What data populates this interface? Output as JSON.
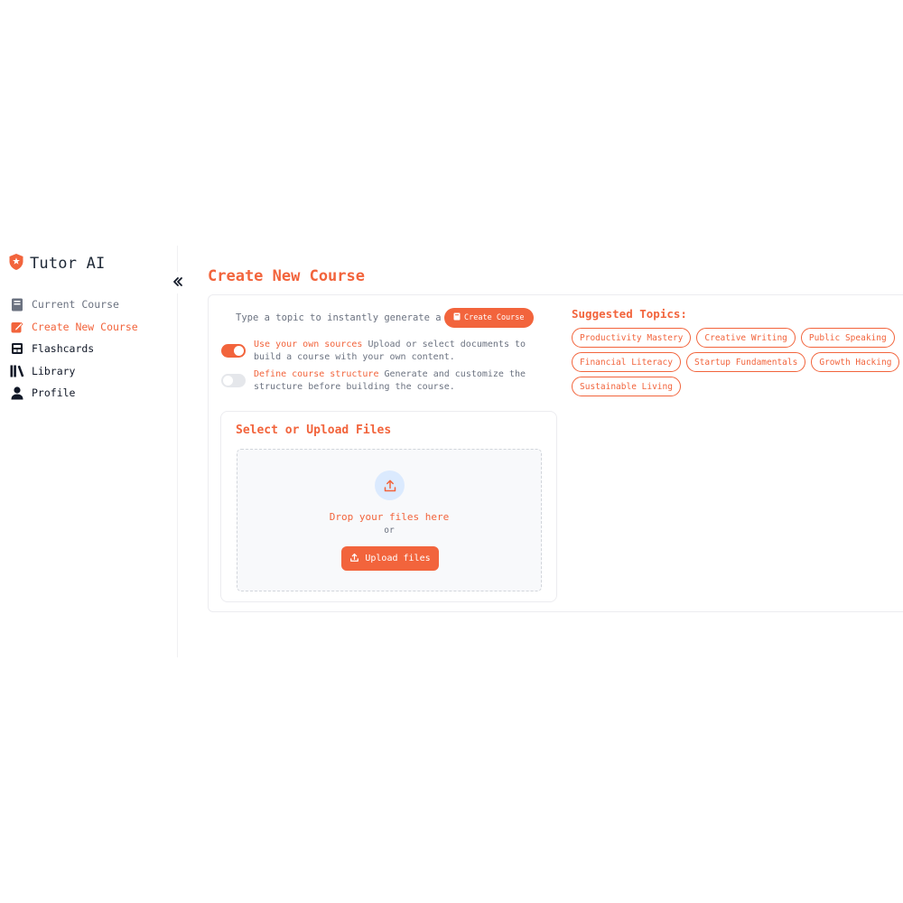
{
  "brand": {
    "name": "Tutor AI"
  },
  "colors": {
    "accent": "#f2643c",
    "icon_bg": "#dbeafe"
  },
  "sidebar": {
    "items": [
      {
        "label": "Current Course",
        "icon": "book-icon",
        "state": "muted"
      },
      {
        "label": "Create New Course",
        "icon": "edit-icon",
        "state": "active"
      },
      {
        "label": "Flashcards",
        "icon": "flashcards-icon",
        "state": "normal"
      },
      {
        "label": "Library",
        "icon": "library-icon",
        "state": "normal"
      },
      {
        "label": "Profile",
        "icon": "user-icon",
        "state": "normal"
      }
    ]
  },
  "main": {
    "title": "Create New Course",
    "topic_input": {
      "placeholder": "Type a topic to instantly generate a course",
      "value": ""
    },
    "create_button": "Create Course",
    "options": [
      {
        "label": "Use your own sources",
        "description": " Upload or select documents to build a course with your own content.",
        "enabled": true
      },
      {
        "label": "Define course structure",
        "description": " Generate and customize the structure before building the course.",
        "enabled": false
      }
    ],
    "upload": {
      "title": "Select or Upload Files",
      "drop_text": "Drop your files here",
      "or_text": "or",
      "button": "Upload files"
    },
    "suggested": {
      "title": "Suggested Topics:",
      "topics": [
        "Productivity Mastery",
        "Creative Writing",
        "Public Speaking",
        "Financial Literacy",
        "Startup Fundamentals",
        "Growth Hacking",
        "Sustainable Living"
      ]
    }
  }
}
